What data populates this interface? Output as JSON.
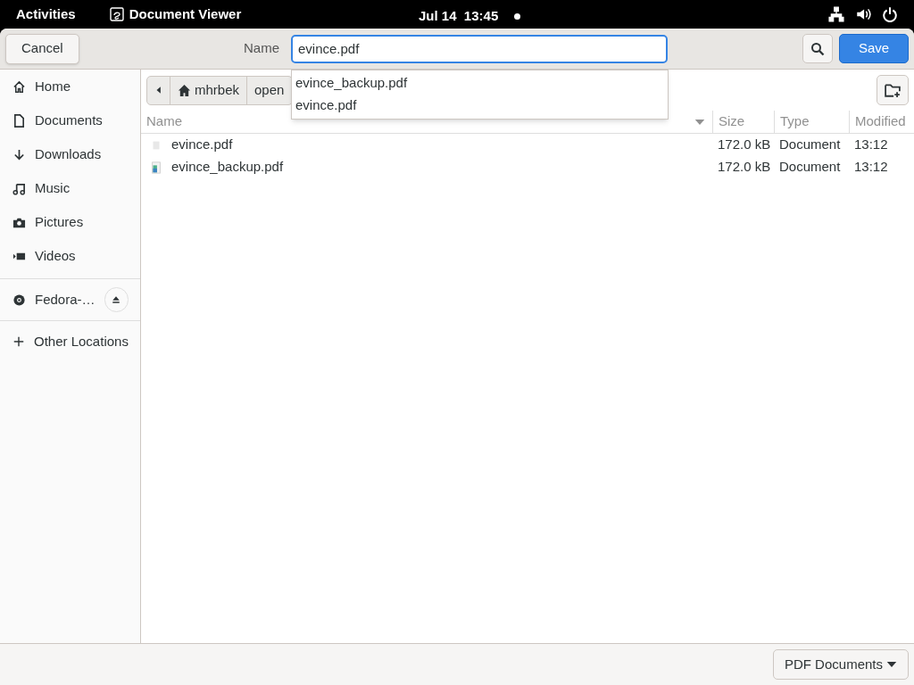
{
  "top_bar": {
    "activities": "Activities",
    "app_name": "Document Viewer",
    "clock": "Jul 14  13:45"
  },
  "header": {
    "cancel": "Cancel",
    "name_label": "Name",
    "name_value": "evince.pdf",
    "save": "Save"
  },
  "autocomplete": [
    "evince_backup.pdf",
    "evince.pdf"
  ],
  "sidebar": {
    "places": [
      {
        "label": "Home"
      },
      {
        "label": "Documents"
      },
      {
        "label": "Downloads"
      },
      {
        "label": "Music"
      },
      {
        "label": "Pictures"
      },
      {
        "label": "Videos"
      }
    ],
    "devices": [
      {
        "label": "Fedora-…"
      }
    ],
    "other": "Other Locations"
  },
  "path_bar": [
    "mhrbek",
    "open"
  ],
  "table": {
    "columns": [
      "Name",
      "Size",
      "Type",
      "Modified"
    ],
    "rows": [
      {
        "kind": "blank",
        "name": "evince.pdf",
        "size": "172.0 kB",
        "type": "Document",
        "modified": "13:12"
      },
      {
        "kind": "preview",
        "name": "evince_backup.pdf",
        "size": "172.0 kB",
        "type": "Document",
        "modified": "13:12"
      }
    ]
  },
  "filter": "PDF Documents"
}
